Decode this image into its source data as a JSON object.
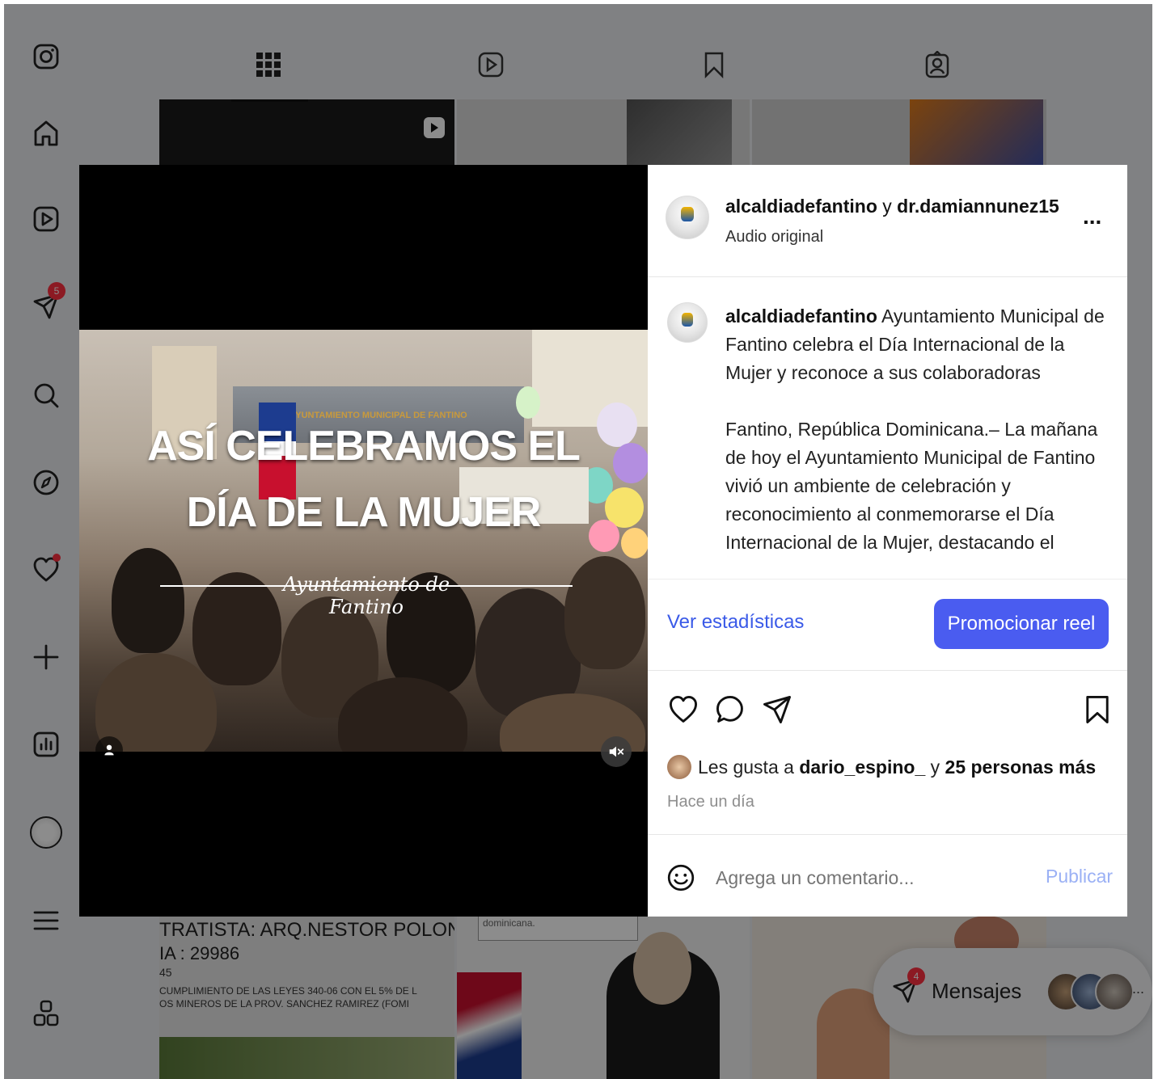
{
  "nav": {
    "icons": [
      "instagram-icon",
      "home-icon",
      "reels-icon",
      "messages-icon",
      "search-icon",
      "explore-icon",
      "notifications-icon",
      "create-icon",
      "dashboard-icon",
      "profile-icon",
      "menu-icon",
      "meta-apps-icon"
    ],
    "messages_badge": "5"
  },
  "tabs": [
    "posts-grid",
    "reels",
    "saved",
    "tagged"
  ],
  "background": {
    "text_1": "TRATISTA: ARQ.NESTOR POLONIA",
    "text_2": "IA : 29986",
    "text_3": "45",
    "text_4": "CUMPLIMIENTO DE LAS LEYES 340-06 CON EL 5% DE L",
    "text_5": "OS MINEROS DE LA PROV. SANCHEZ RAMIREZ (FOMI",
    "text_6": "dominicana."
  },
  "media": {
    "title_line1": "ASÍ CELEBRAMOS EL",
    "title_line2": "DÍA DE LA MUJER",
    "signature": "Ayuntamiento de Fantino",
    "banner": "AYUNTAMIENTO MUNICIPAL DE FANTINO"
  },
  "post": {
    "author": "alcaldiadefantino",
    "connector": "y",
    "collaborator": "dr.damiannunez15",
    "audio": "Audio original",
    "more": "...",
    "caption_author": "alcaldiadefantino",
    "caption_title": "Ayuntamiento Municipal de Fantino celebra el Día Internacional de la Mujer y reconoce a sus colaboradoras",
    "caption_body": "Fantino, República Dominicana.– La mañana de hoy el Ayuntamiento Municipal de Fantino vivió un ambiente de celebración y reconocimiento al conmemorarse el Día Internacional de la Mujer, destacando el valioso aporte de las mujeres que día tras día contribuyen con su trabajo y",
    "stats_link": "Ver estadísticas",
    "promote_button": "Promocionar reel",
    "likes_prefix": "Les gusta a",
    "likes_user": "dario_espino_",
    "likes_connector": "y",
    "likes_count": "25 personas más",
    "time": "Hace un día",
    "comment_placeholder": "Agrega un comentario...",
    "publish": "Publicar"
  },
  "messages": {
    "label": "Mensajes",
    "badge": "4",
    "more": "..."
  },
  "colors": {
    "accent": "#4a5cf0",
    "link": "#3a5ae8",
    "badge": "#ff3040",
    "publish_disabled": "#9bb1f5"
  }
}
